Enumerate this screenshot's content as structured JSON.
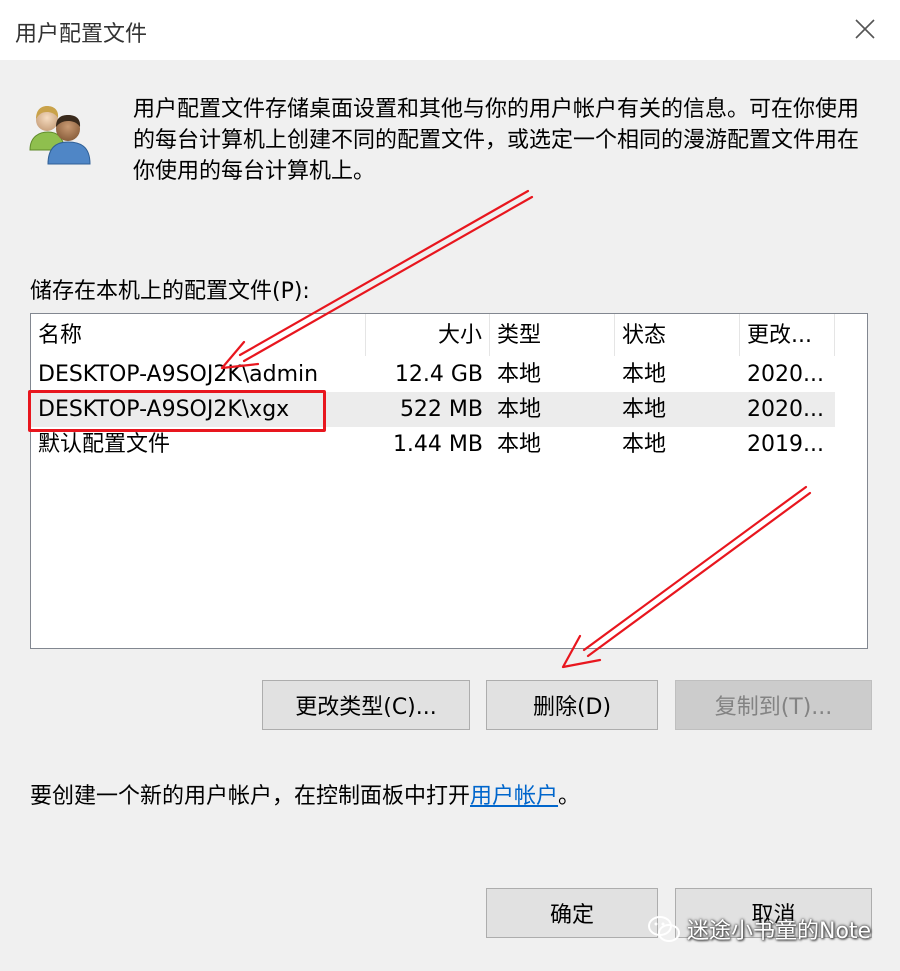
{
  "window": {
    "title": "用户配置文件"
  },
  "description": "用户配置文件存储桌面设置和其他与你的用户帐户有关的信息。可在你使用的每台计算机上创建不同的配置文件，或选定一个相同的漫游配置文件用在你使用的每台计算机上。",
  "list": {
    "label": "储存在本机上的配置文件(P):",
    "columns": [
      "名称",
      "大小",
      "类型",
      "状态",
      "更改..."
    ],
    "rows": [
      {
        "name": "DESKTOP-A9SOJ2K\\admin",
        "size": "12.4 GB",
        "type": "本地",
        "status": "本地",
        "modified": "2020..."
      },
      {
        "name": "DESKTOP-A9SOJ2K\\xgx",
        "size": "522 MB",
        "type": "本地",
        "status": "本地",
        "modified": "2020..."
      },
      {
        "name": "默认配置文件",
        "size": "1.44 MB",
        "type": "本地",
        "status": "本地",
        "modified": "2019..."
      }
    ]
  },
  "buttons": {
    "change_type": "更改类型(C)...",
    "delete": "删除(D)",
    "copy_to": "复制到(T)...",
    "ok": "确定",
    "cancel": "取消"
  },
  "bottom": {
    "prefix": "要创建一个新的用户帐户，在控制面板中打开",
    "link": "用户帐户",
    "suffix": "。"
  },
  "watermark": "迷途小书童的Note",
  "colors": {
    "annotation": "#e8161e",
    "link": "#0066cc",
    "selected_row": "#ececec"
  },
  "icons": {
    "users": "users-icon",
    "close": "close-icon",
    "watermark": "wechat-icon"
  }
}
